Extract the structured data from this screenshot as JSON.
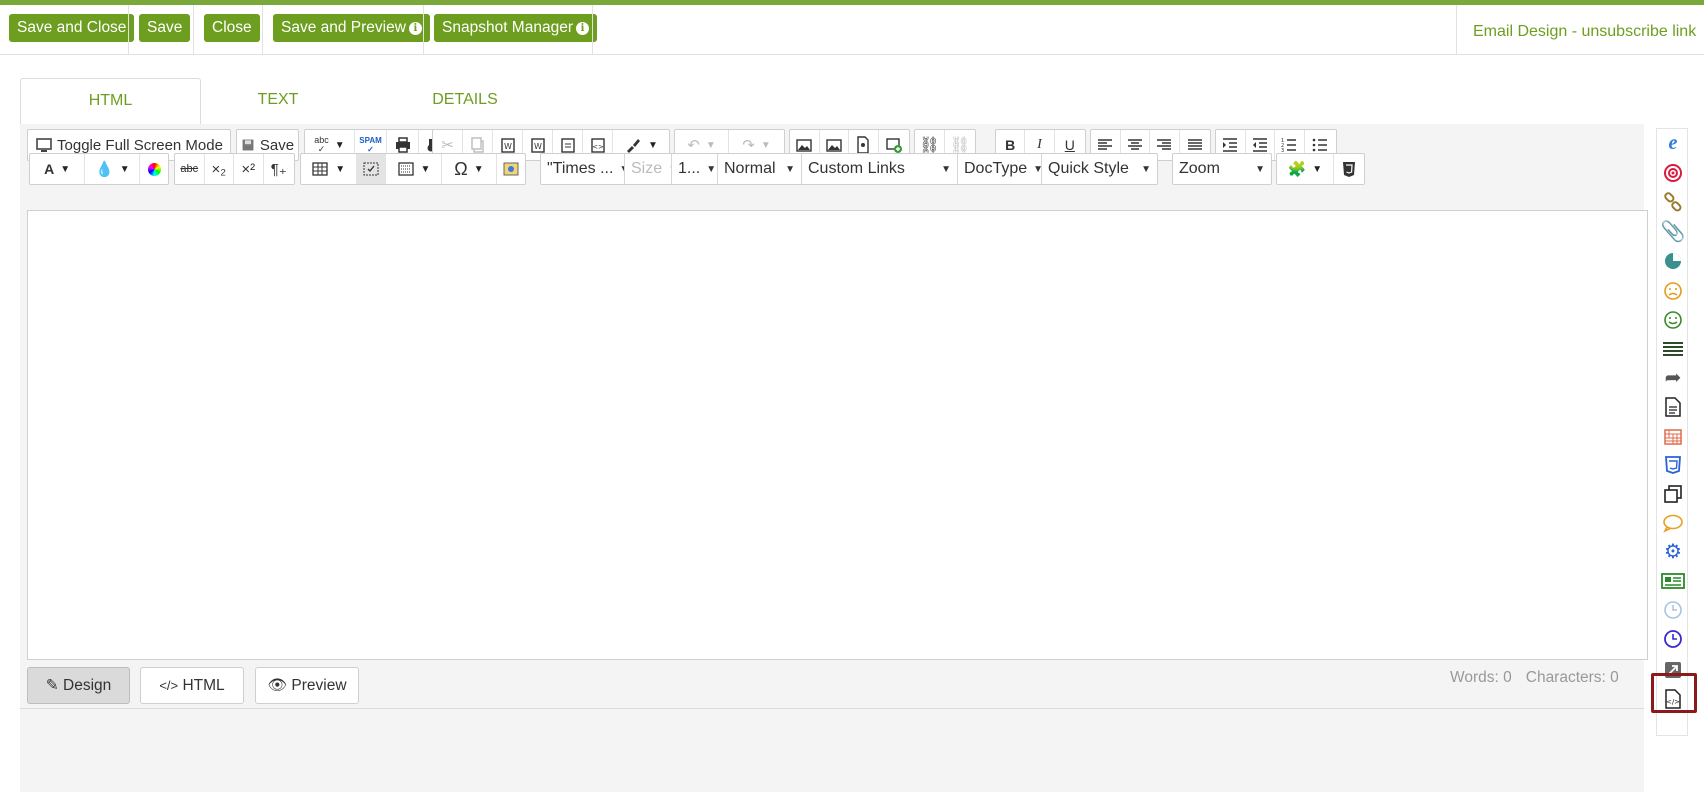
{
  "topbar": {
    "buttons": {
      "save_close": "Save and Close",
      "save": "Save",
      "close": "Close",
      "save_preview": "Save and Preview",
      "snapshot": "Snapshot Manager"
    },
    "info_glyph": "i",
    "title": "Email Design - unsubscribe link"
  },
  "tabs": [
    "HTML",
    "TEXT",
    "DETAILS"
  ],
  "toolbar": {
    "fullscreen_label": "Toggle Full Screen Mode",
    "save_label": "Save",
    "text_color_glyph": "A",
    "special_char_glyph": "Ω",
    "font_name": "\"Times ...",
    "font_size": "Size",
    "line_height": "1...",
    "format": "Normal",
    "custom_links": "Custom Links",
    "doctype": "DocType",
    "quick_style": "Quick Style",
    "zoom": "Zoom",
    "bold": "B",
    "italic": "I",
    "underline": "U",
    "spam": "SPAM",
    "abc": "abc"
  },
  "modes": {
    "design": "Design",
    "html": "HTML",
    "preview": "Preview"
  },
  "counts": {
    "words": "Words: 0",
    "characters": "Characters: 0"
  },
  "colors": {
    "brand_green": "#6d9e1f",
    "highlight": "#8b1a1a"
  },
  "rail_icons": [
    "ie-browser-icon",
    "target-icon",
    "link-chain-icon",
    "paperclip-icon",
    "pie-chart-icon",
    "sad-face-icon",
    "smile-face-icon",
    "list-lines-icon",
    "forward-arrow-icon",
    "document-icon",
    "calendar-icon",
    "css3-icon",
    "copy-pages-icon",
    "speech-bubble-icon",
    "gears-icon",
    "newsletter-icon",
    "clock-light-icon",
    "clock-icon",
    "external-link-icon",
    "code-file-icon"
  ]
}
